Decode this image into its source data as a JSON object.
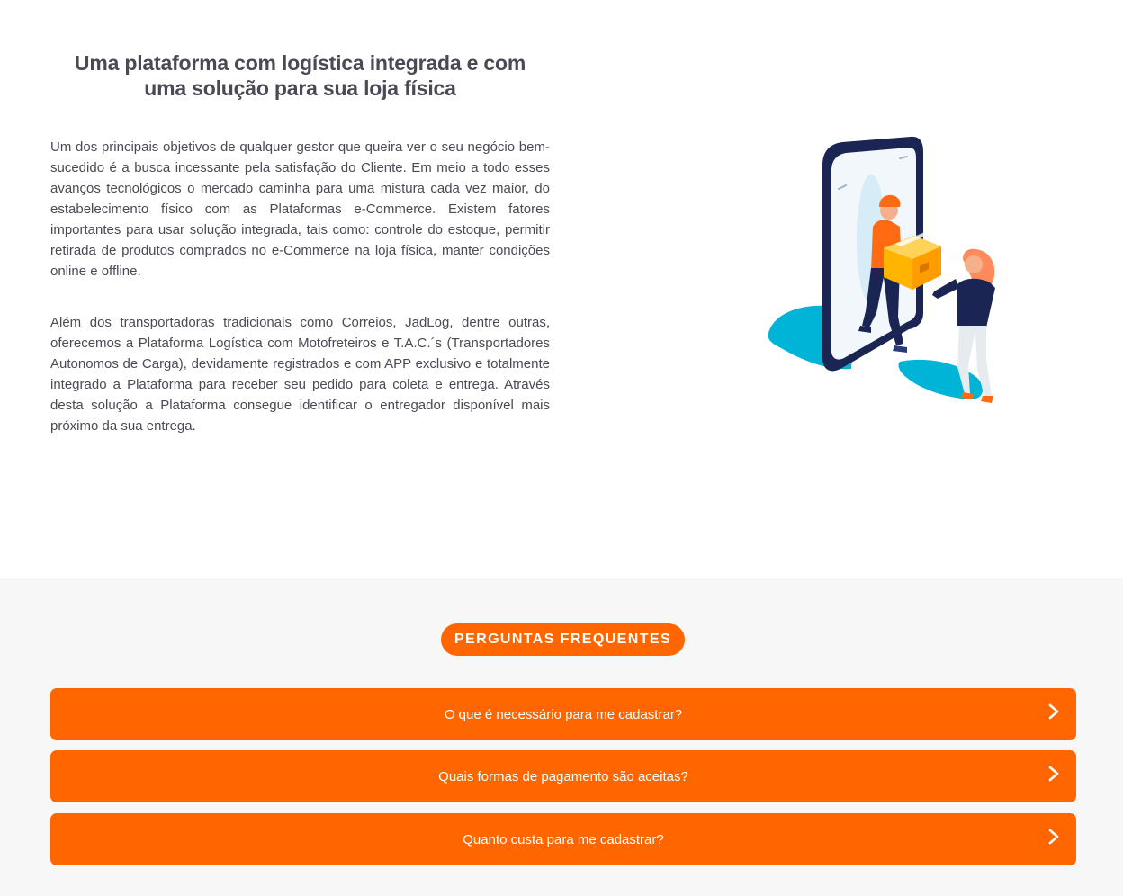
{
  "intro": {
    "title_line1": "Uma plataforma com logística integrada e com",
    "title_line2": "uma solução para sua loja física",
    "paragraph1": "Um dos principais objetivos de qualquer gestor que queira ver o seu negócio bem-sucedido é a busca incessante pela satisfação do Cliente. Em meio a todo esses avanços tecnológicos o mercado caminha para uma mistura cada vez maior, do estabelecimento físico com as Plataformas e-Commerce. Existem fatores importantes para usar solução integrada, tais como: controle do estoque, permitir retirada de produtos comprados no e-Commerce na loja física, manter condições online e offline.",
    "paragraph2": "Além dos transportadoras tradicionais como Correios, JadLog, dentre outras, oferecemos a Plataforma Logística com Motofreteiros e T.A.C.´s (Transportadores Autonomos de Carga), devidamente registrados e com APP exclusivo e totalmente integrado a Plataforma para receber seu pedido para coleta e entrega. Através desta solução a Plataforma consegue identificar o entregador disponível mais próximo da sua entrega.",
    "illustration_icon": "delivery-illustration"
  },
  "faq": {
    "heading": "PERGUNTAS FREQUENTES",
    "items": [
      {
        "question": "O que é necessário para me cadastrar?",
        "icon": "chevron-right-icon"
      },
      {
        "question": "Quais formas de pagamento são aceitas?",
        "icon": "chevron-right-icon"
      },
      {
        "question": "Quanto custa para me cadastrar?",
        "icon": "chevron-right-icon"
      }
    ]
  },
  "colors": {
    "accent": "#ff6600",
    "text": "#4a4a55",
    "faq_background": "#f7f7f7",
    "teal": "#00b4d8",
    "navy": "#1b2553"
  }
}
